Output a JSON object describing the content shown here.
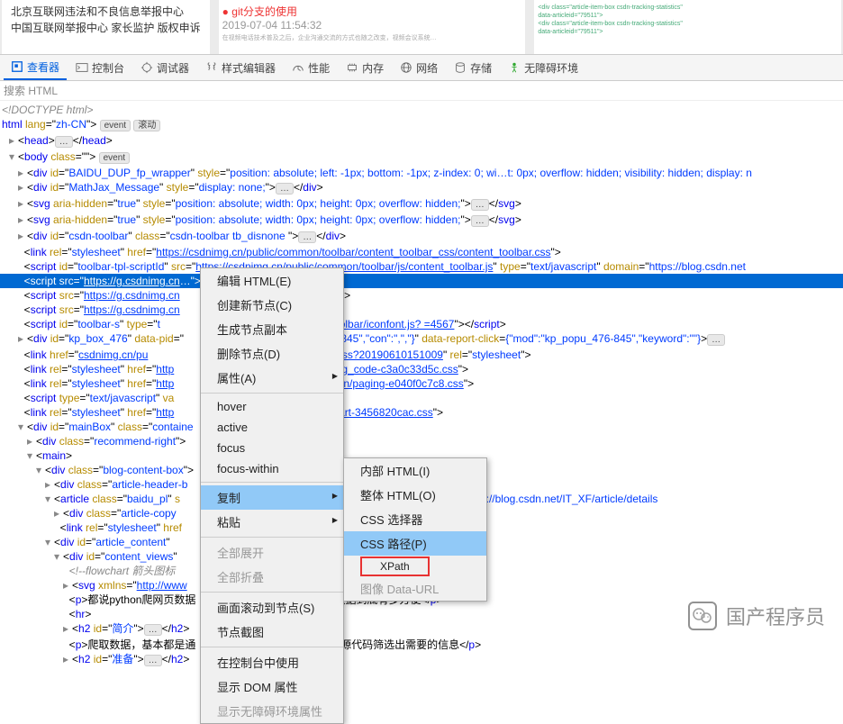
{
  "preview": {
    "line1": "北京互联网违法和不良信息举报中心",
    "line2": "中国互联网举报中心  家长监护  版权申诉",
    "thumb1_title": "git分支的使用",
    "thumb1_date": "2019-07-04 11:54:32"
  },
  "tabs": {
    "inspector": "查看器",
    "console": "控制台",
    "debugger": "调试器",
    "style": "样式编辑器",
    "perf": "性能",
    "memory": "内存",
    "network": "网络",
    "storage": "存储",
    "a11y": "无障碍环境"
  },
  "search": {
    "placeholder": "搜索 HTML"
  },
  "badges": {
    "event": "event",
    "scroll": "滚动"
  },
  "dom": {
    "doctype": "<!DOCTYPE html>",
    "html_open": "html lang=\"zh-CN\">",
    "head": "<head>…</head>",
    "body": "body class=\"\">",
    "baidu_dup": "<div id=\"BAIDU_DUP_fp_wrapper\" style=\"position: absolute; left: -1px; bottom: -1px; z-index: 0; wi…t: 0px; overflow: hidden; visibility: hidden; display: n",
    "mathjax": "<div id=\"MathJax_Message\" style=\"display: none;\">…</div>",
    "svg1": "<svg aria-hidden=\"true\" style=\"position: absolute; width: 0px; height: 0px; overflow: hidden;\">…</svg>",
    "svg2": "<svg aria-hidden=\"true\" style=\"position: absolute; width: 0px; height: 0px; overflow: hidden;\">…</svg>",
    "toolbar_div": "<div id=\"csdn-toolbar\" class=\"csdn-toolbar tb_disnone \">…</div>",
    "link_toolbar_css": "<link rel=\"stylesheet\" href=\"https://csdnimg.cn/public/common/toolbar/content_toolbar_css/content_toolbar.css\">",
    "script_toolbar_js": "<script id=\"toolbar-tpl-scriptId\" src=\"https://csdnimg.cn/public/common/toolbar/js/content_toolbar.js\" type=\"text/javascript\" domain=\"https://blog.csdn.net",
    "selected_script": "<script src=\"https://g.csdnimg.cn…\"></script>",
    "script_g1": "<script src=\"https://g.csdnimg.cn\"></script>",
    "script_g2": "<script src=\"https://g.csdnimg.cn\"…pt>",
    "script_toolbars": "<script id=\"toolbar-s\" type=\"t…ng.cn/cdn/content-toolbar/iconfont.js? =4567\"></script>",
    "kp_box": "<div id=\"kp_box_476\" data-pid=\"…:\"kp_popu_476-845\",\"con\":\",\",\"}\" data-report-click={\"mod\":\"kp_popu_476-845\",\"keyword\":\"\"}>…",
    "link_pu": "<link href=\"csdnimg.cn/pu…1/indexSuperise.css?20190610151009\" rel=\"stylesheet\">",
    "link_blog_code": "<link rel=\"stylesheet\" href=\"http…x/template/css/blog_code-c3a0c33d5c.css\">",
    "link_pagination": "<link rel=\"stylesheet\" href=\"http…x/vendor/pagination/paging-e040f0c7c8.css\">",
    "script_va": "<script type=\"text/javascript\" va…cript>",
    "link_chart": "<link rel=\"stylesheet\" href=\"http…x/template/css/chart-3456820cac.css\">",
    "mainbox": "<div id=\"mainBox\" class=\"containe",
    "recommend": "<div class=\"recommend-right\">",
    "main": "<main>",
    "blog_content": "<div class=\"blog-content-box\">",
    "article_header": "<div class=\"article-header-b",
    "article": "<article class=\"baidu_pl\" s…={\"mod\":\"popu_307\",\"dest\":\"https://blog.csdn.net/IT_XF/article/details",
    "article_copy": "<div class=\"article-copy",
    "link_ck": "<link rel=\"stylesheet\" href…/ck_htmledit_views-3019150162.css\">",
    "article_content": "<div id=\"article_content\"",
    "content_views": "<div id=\"content_views\"",
    "flowchart": "<!--flowchart 箭头图标",
    "svg_xmlns": "<svg xmlns=\"http://www",
    "p_python": "<p>都说python爬网页数据",
    "hr": "<hr>",
    "h2_intro": "<h2 id=\"简介\">…</h2>…提取数据到底有多方便</p>",
    "p_crawl": "<p>爬取数据，基本都是通…根据源代码筛选出需要的信息</p>",
    "h2_prep": "<h2 id=\"准备\">…</h2>"
  },
  "menu1": {
    "edit_html": "编辑 HTML(E)",
    "create_node": "创建新节点(C)",
    "gen_copy": "生成节点副本",
    "del_node": "删除节点(D)",
    "attrs": "属性(A)",
    "hover": "hover",
    "active": "active",
    "focus": "focus",
    "focus_within": "focus-within",
    "copy": "复制",
    "paste": "粘贴",
    "expand_all": "全部展开",
    "collapse_all": "全部折叠",
    "scroll_to": "画面滚动到节点(S)",
    "screenshot": "节点截图",
    "use_console": "在控制台中使用",
    "show_dom": "显示 DOM 属性",
    "show_a11y": "显示无障碍环境属性"
  },
  "menu2": {
    "inner_html": "内部 HTML(I)",
    "outer_html": "整体 HTML(O)",
    "css_sel": "CSS 选择器",
    "css_path": "CSS 路径(P)",
    "xpath": "XPath",
    "img_data": "图像 Data-URL"
  },
  "watermark": "国产程序员"
}
